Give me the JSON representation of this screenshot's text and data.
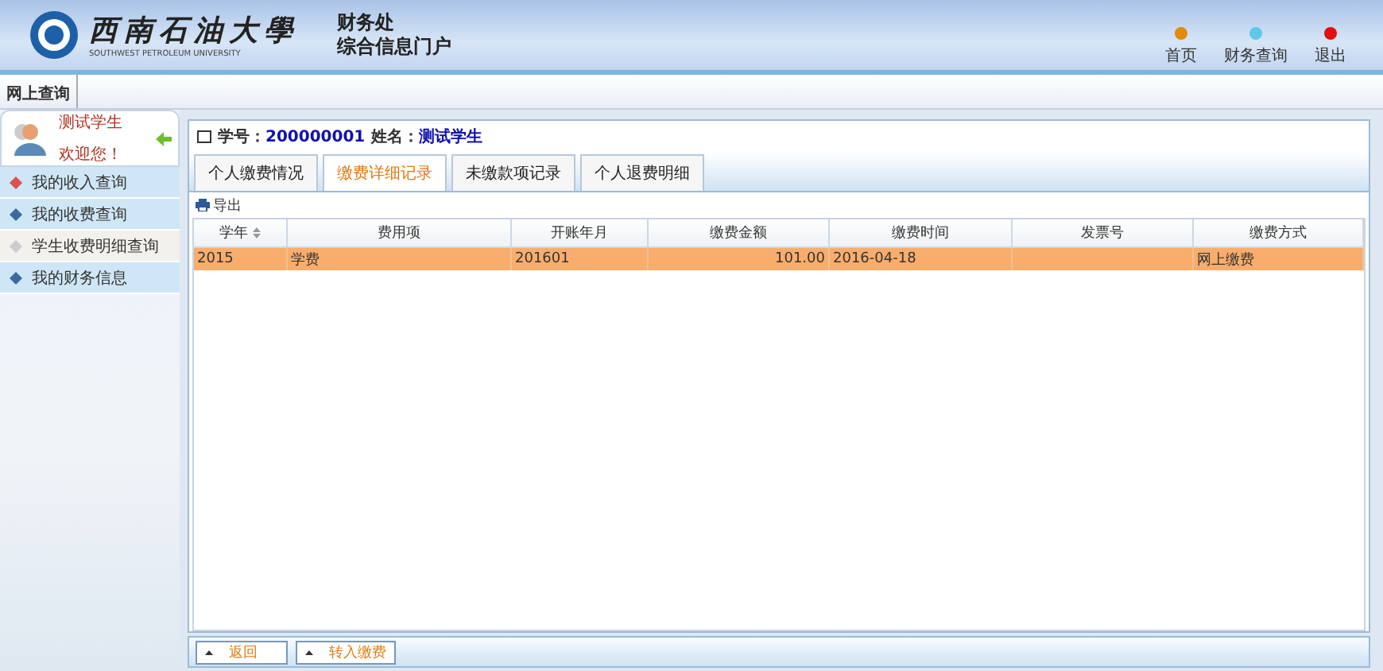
{
  "header": {
    "logo_text": "西南石油大學",
    "logo_subtext": "SOUTHWEST PETROLEUM UNIVERSITY",
    "title_lines": [
      "财务处",
      "综合信息门户"
    ],
    "nav": [
      {
        "label": "首页",
        "color": "#e08a10"
      },
      {
        "label": "财务查询",
        "color": "#5fc8e8"
      },
      {
        "label": "退出",
        "color": "#e01010"
      }
    ]
  },
  "top_tabs": [
    {
      "label": "网上查询",
      "selected": true
    }
  ],
  "user": {
    "name": "测试学生",
    "greeting": "欢迎您！"
  },
  "sidebar": {
    "items": [
      {
        "label": "我的收入查询",
        "kind": "red",
        "selected": false
      },
      {
        "label": "我的收费查询",
        "kind": "blue",
        "selected": false
      },
      {
        "label": "学生收费明细查询",
        "kind": "plain",
        "selected": true
      },
      {
        "label": "我的财务信息",
        "kind": "blue",
        "selected": false
      }
    ]
  },
  "student": {
    "id_label": "学号：",
    "id": "200000001",
    "name_label": "姓名：",
    "name": "测试学生"
  },
  "tabs": [
    {
      "label": "个人缴费情况",
      "selected": false
    },
    {
      "label": "缴费详细记录",
      "selected": true
    },
    {
      "label": "未缴款项记录",
      "selected": false
    },
    {
      "label": "个人退费明细",
      "selected": false
    }
  ],
  "toolbar": {
    "export": "导出"
  },
  "table": {
    "columns": [
      {
        "label": "学年",
        "sortable": true
      },
      {
        "label": "费用项",
        "sortable": false
      },
      {
        "label": "开账年月",
        "sortable": false
      },
      {
        "label": "缴费金额",
        "sortable": false
      },
      {
        "label": "缴费时间",
        "sortable": false
      },
      {
        "label": "发票号",
        "sortable": false
      },
      {
        "label": "缴费方式",
        "sortable": false
      }
    ],
    "rows": [
      {
        "selected": true,
        "cells": [
          "2015",
          "学费",
          "201601",
          "101.00",
          "2016-04-18",
          "",
          "网上缴费"
        ]
      }
    ]
  },
  "buttons": [
    "返回",
    "转入缴费"
  ]
}
